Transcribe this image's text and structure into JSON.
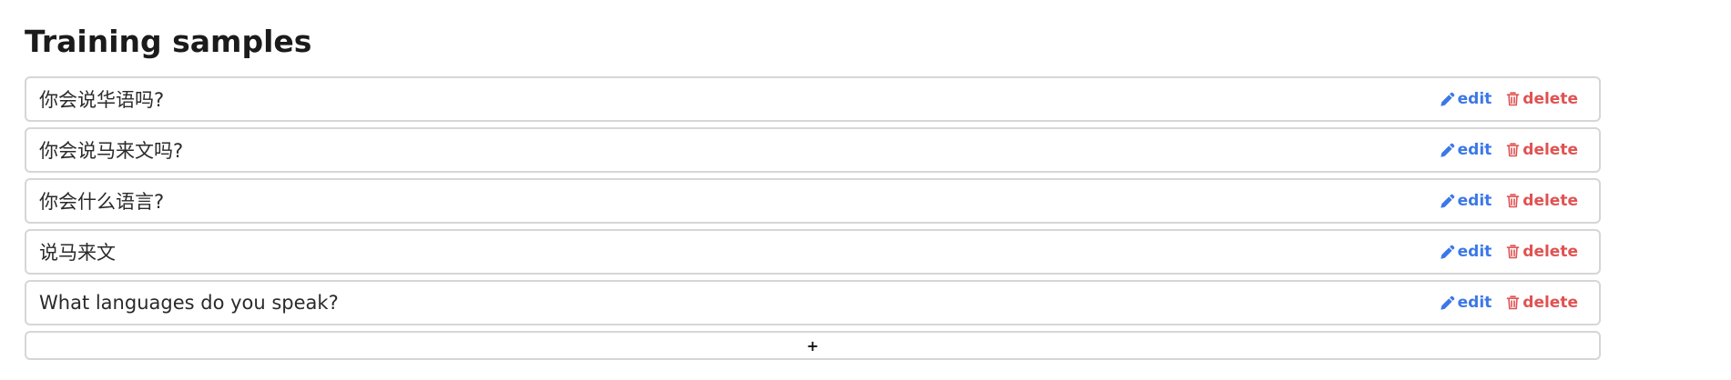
{
  "section": {
    "title": "Training samples"
  },
  "samples": [
    {
      "text": "你会说华语吗?"
    },
    {
      "text": "你会说马来文吗?"
    },
    {
      "text": "你会什么语言?"
    },
    {
      "text": "说马来文"
    },
    {
      "text": "What languages do you speak?"
    }
  ],
  "actions": {
    "edit_label": "edit",
    "delete_label": "delete",
    "edit_icon": "pencil-icon",
    "delete_icon": "trash-icon",
    "edit_color": "#3b78e7",
    "delete_color": "#e05252"
  },
  "add": {
    "label": "+"
  }
}
